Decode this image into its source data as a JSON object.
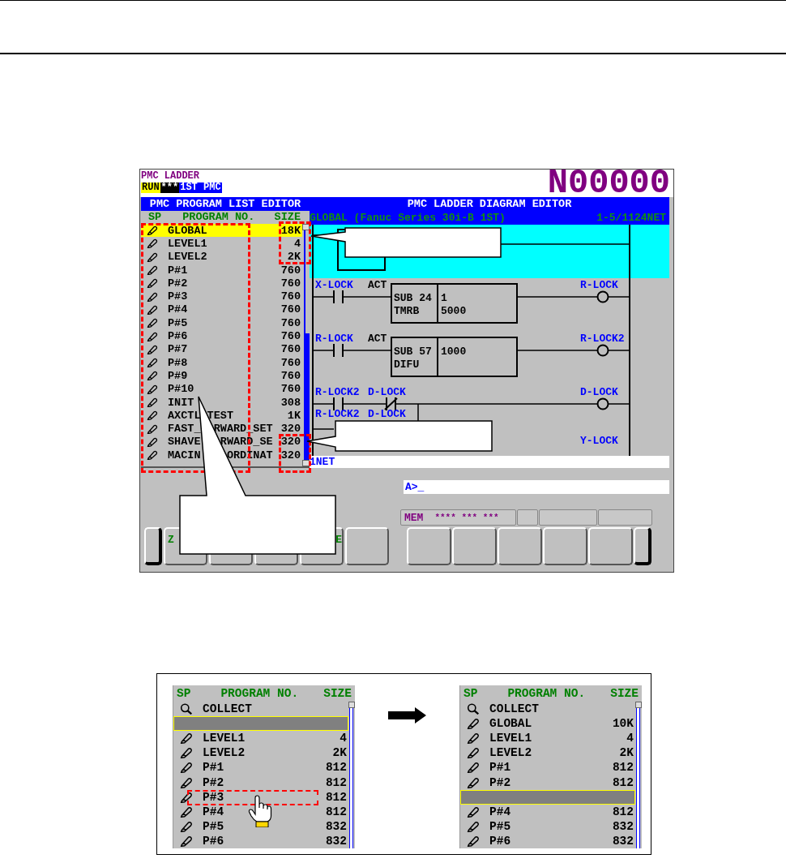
{
  "screen": {
    "title": "PMC LADDER",
    "indicators": [
      {
        "text": "RUN",
        "kind": "mode"
      },
      {
        "text": "***",
        "kind": "alarm"
      },
      {
        "text": "1ST PMC",
        "kind": "path"
      }
    ],
    "program_number": "N00000",
    "program_list": {
      "title": "PMC PROGRAM LIST EDITOR",
      "columns": [
        "SP",
        "PROGRAM NO.",
        "SIZE"
      ],
      "rows": [
        {
          "name": "GLOBAL",
          "size": "18K",
          "selected": true
        },
        {
          "name": "LEVEL1",
          "size": "4",
          "selected": false
        },
        {
          "name": "LEVEL2",
          "size": "2K",
          "selected": false
        },
        {
          "name": "P#1",
          "size": "760",
          "selected": false
        },
        {
          "name": "P#2",
          "size": "760",
          "selected": false
        },
        {
          "name": "P#3",
          "size": "760",
          "selected": false
        },
        {
          "name": "P#4",
          "size": "760",
          "selected": false
        },
        {
          "name": "P#5",
          "size": "760",
          "selected": false
        },
        {
          "name": "P#6",
          "size": "760",
          "selected": false
        },
        {
          "name": "P#7",
          "size": "760",
          "selected": false
        },
        {
          "name": "P#8",
          "size": "760",
          "selected": false
        },
        {
          "name": "P#9",
          "size": "760",
          "selected": false
        },
        {
          "name": "P#10",
          "size": "760",
          "selected": false
        },
        {
          "name": "INIT",
          "size": "308",
          "selected": false
        },
        {
          "name": "AXCTL TEST",
          "size": "1K",
          "selected": false
        },
        {
          "name": "FAST_  RWARD_SET",
          "size": "320",
          "selected": false
        },
        {
          "name": "SHAVE   RWARD_SE",
          "size": "320",
          "selected": false
        },
        {
          "name": "MACIN    ORDINAT",
          "size": "320",
          "selected": false
        }
      ]
    },
    "ladder": {
      "title": "PMC LADDER DIAGRAM EDITOR",
      "program": "GLOBAL (Fanuc Series 30i-B 1ST)",
      "position": "1-5/1124NET",
      "footer": "1NET",
      "rungs": [
        {
          "kind": "end",
          "selected": true
        },
        {
          "kind": "function",
          "input": "X-LOCK",
          "act": "ACT",
          "function": [
            "SUB 24",
            "TMRB"
          ],
          "parameters": [
            "1",
            "5000"
          ],
          "coil": "R-LOCK"
        },
        {
          "kind": "function",
          "input": "R-LOCK",
          "act": "ACT",
          "function": [
            "SUB 57",
            "DIFU"
          ],
          "parameters": [
            "1000"
          ],
          "coil": "R-LOCK2"
        },
        {
          "kind": "self_hold",
          "contacts": [
            "R-LOCK2",
            "D-LOCK"
          ],
          "branch": [
            "R-LOCK2",
            "D-LOCK"
          ],
          "coil": "D-LOCK"
        },
        {
          "kind": "coil_label",
          "coil": "Y-LOCK"
        }
      ]
    },
    "command_line": "A>_",
    "status_bar": {
      "mode": "MEM",
      "indicators": "**** *** ***"
    },
    "softkeys": [
      {
        "kind": "leading",
        "label": "Z"
      },
      {
        "kind": "blank"
      },
      {
        "kind": "blank"
      },
      {
        "kind": "trailing",
        "label": "E"
      },
      {
        "kind": "blank"
      }
    ]
  },
  "example": {
    "before": {
      "columns": [
        "SP",
        "PROGRAM NO.",
        "SIZE"
      ],
      "rows": [
        {
          "kind": "collect",
          "name": "COLLECT",
          "selected": false,
          "pointed": false
        },
        {
          "kind": "blank",
          "selected": true,
          "pointed": false
        },
        {
          "kind": "program",
          "name": "LEVEL1",
          "size": "4",
          "selected": false,
          "pointed": false
        },
        {
          "kind": "program",
          "name": "LEVEL2",
          "size": "2K",
          "selected": false,
          "pointed": false
        },
        {
          "kind": "program",
          "name": "P#1",
          "size": "812",
          "selected": false,
          "pointed": false
        },
        {
          "kind": "program",
          "name": "P#2",
          "size": "812",
          "selected": false,
          "pointed": false
        },
        {
          "kind": "program",
          "name": "P#3",
          "size": "812",
          "selected": false,
          "pointed": true
        },
        {
          "kind": "program",
          "name": "P#4",
          "size": "812",
          "selected": false,
          "pointed": false
        },
        {
          "kind": "program",
          "name": "P#5",
          "size": "832",
          "selected": false,
          "pointed": false
        },
        {
          "kind": "program",
          "name": "P#6",
          "size": "832",
          "selected": false,
          "pointed": false
        }
      ]
    },
    "after": {
      "columns": [
        "SP",
        "PROGRAM NO.",
        "SIZE"
      ],
      "rows": [
        {
          "kind": "collect",
          "name": "COLLECT",
          "selected": false
        },
        {
          "kind": "program",
          "name": "GLOBAL",
          "size": "10K",
          "selected": false
        },
        {
          "kind": "program",
          "name": "LEVEL1",
          "size": "4",
          "selected": false
        },
        {
          "kind": "program",
          "name": "LEVEL2",
          "size": "2K",
          "selected": false
        },
        {
          "kind": "program",
          "name": "P#1",
          "size": "812",
          "selected": false
        },
        {
          "kind": "program",
          "name": "P#2",
          "size": "812",
          "selected": false
        },
        {
          "kind": "blank",
          "selected": true
        },
        {
          "kind": "program",
          "name": "P#4",
          "size": "812",
          "selected": false
        },
        {
          "kind": "program",
          "name": "P#5",
          "size": "832",
          "selected": false
        },
        {
          "kind": "program",
          "name": "P#6",
          "size": "832",
          "selected": false
        }
      ]
    }
  }
}
